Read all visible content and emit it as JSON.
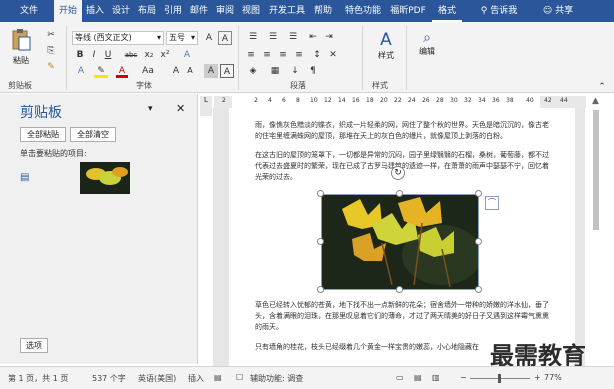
{
  "tabs": [
    "文件",
    "开始",
    "插入",
    "设计",
    "布局",
    "引用",
    "邮件",
    "审阅",
    "视图",
    "开发工具",
    "帮助",
    "特色功能",
    "福昕PDF",
    "格式"
  ],
  "tell_me": "告诉我",
  "share": "共享",
  "ribbon": {
    "paste": "粘贴",
    "font_name": "等线 (西文正文)",
    "font_size": "五号",
    "bold": "B",
    "italic": "I",
    "underline": "U",
    "strike": "abc",
    "sub": "x₂",
    "sup": "x²",
    "aa": "Aa",
    "char_a": "A",
    "style": "样式",
    "edit": "编辑",
    "groups": {
      "clipboard": "剪贴板",
      "font": "字体",
      "paragraph": "段落",
      "styles": "样式",
      "editing": ""
    }
  },
  "pane": {
    "title": "剪贴板",
    "paste_all": "全部粘贴",
    "clear_all": "全部清空",
    "hint": "单击要粘贴的项目:",
    "options": "选项"
  },
  "ruler": {
    "ticks": [
      "2",
      "2",
      "4",
      "6",
      "8",
      "10",
      "12",
      "14",
      "16",
      "18",
      "20",
      "22",
      "24",
      "26",
      "28",
      "30",
      "32",
      "34",
      "36",
      "38",
      "40",
      "42",
      "44"
    ]
  },
  "doc": {
    "p1": "雨，像憔灰色黯淡的蝶衣，织成一片轻柔的网，网住了整个秋的世界。天色是暗沉沉的，像古老的住宅里缠满蛛网的屋顶，那堆在天上的灰白色的缦片，就像屋顶上剥落的白粉。",
    "p2": "在这古旧的屋顶的笼罩下，一切都是异常的沉闷，园子里绿翳翳的石榴，桑树，葡萄藤，都不过代表过去盛夏时的繁荣，现在已成了古罗马建筑的遗迹一样，在萧萧的雨声中瑟瑟不宁，回忆着光荣的过去。",
    "p3": "草色已经转入忧郁的苍黄，地下找不出一点新鲜的花朵；宿舍墙外一带种的娇嫩的洋水仙，垂了头，含着满眼的泪珠，在那里叹息着它们的薄命，才过了两天晴美的好日子又遇到这样霉气熏熏的雨天。",
    "p4": "只有墙角的桂花，枝头已经缀着几个黄金一样宝贵的嫩蕊，小心地隐藏在"
  },
  "status": {
    "page": "第 1 页，共 1 页",
    "words": "537 个字",
    "lang": "英语(美国)",
    "insert": "插入",
    "accessibility": "辅助功能: 调查",
    "zoom": "77%"
  },
  "watermark": "最需教育",
  "colors": {
    "accent": "#2b579a",
    "leaf": "#e8c020"
  }
}
